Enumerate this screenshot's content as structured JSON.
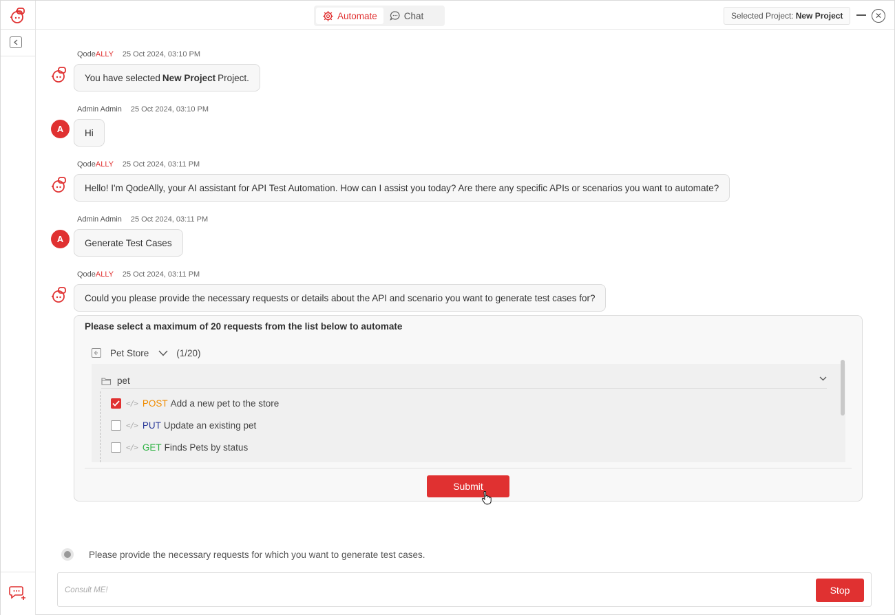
{
  "colors": {
    "accent": "#e03131",
    "post": "#f08c00",
    "put": "#2b3a9a",
    "get": "#2fb344"
  },
  "sidebar": {
    "logo_icon": "qodeally-logo-icon",
    "collapse_icon": "collapse-left-icon",
    "new_chat_icon": "new-chat-icon"
  },
  "header": {
    "tabs": [
      {
        "label": "Automate",
        "icon": "gear-sparkle-icon",
        "active": true
      },
      {
        "label": "Chat",
        "icon": "chat-bubble-icon",
        "active": false
      }
    ],
    "project_label": "Selected Project:",
    "project_name": "New Project"
  },
  "messages": [
    {
      "sender_prefix": "Qode",
      "sender_suffix": "ALLY",
      "time": "25 Oct 2024, 03:10 PM",
      "text_before": "You have selected",
      "text_bold": "New Project",
      "text_after": "Project."
    },
    {
      "sender": "Admin Admin",
      "avatar": "A",
      "time": "25 Oct 2024, 03:10 PM",
      "text": "Hi"
    },
    {
      "sender_prefix": "Qode",
      "sender_suffix": "ALLY",
      "time": "25 Oct 2024, 03:11 PM",
      "text": "Hello! I'm QodeAlly, your AI assistant for API Test Automation. How can I assist you today? Are there any specific APIs or scenarios you want to automate?"
    },
    {
      "sender": "Admin Admin",
      "avatar": "A",
      "time": "25 Oct 2024, 03:11 PM",
      "text": "Generate Test Cases"
    },
    {
      "sender_prefix": "Qode",
      "sender_suffix": "ALLY",
      "time": "25 Oct 2024, 03:11 PM",
      "text": "Could you please provide the necessary requests or details about the API and scenario you want to generate test cases for?"
    }
  ],
  "selector": {
    "title": "Please select a maximum of 20 requests from the list below to automate",
    "collection_name": "Pet Store",
    "count": "(1/20)",
    "folder_name": "pet",
    "requests": [
      {
        "method": "POST",
        "name": "Add a new pet to the store",
        "checked": true
      },
      {
        "method": "PUT",
        "name": "Update an existing pet",
        "checked": false
      },
      {
        "method": "GET",
        "name": "Finds Pets by status",
        "checked": false
      }
    ],
    "submit_label": "Submit"
  },
  "status_text": "Please provide the necessary requests for which you want to generate test cases.",
  "composer": {
    "placeholder": "Consult ME!",
    "value": "",
    "stop_label": "Stop"
  }
}
